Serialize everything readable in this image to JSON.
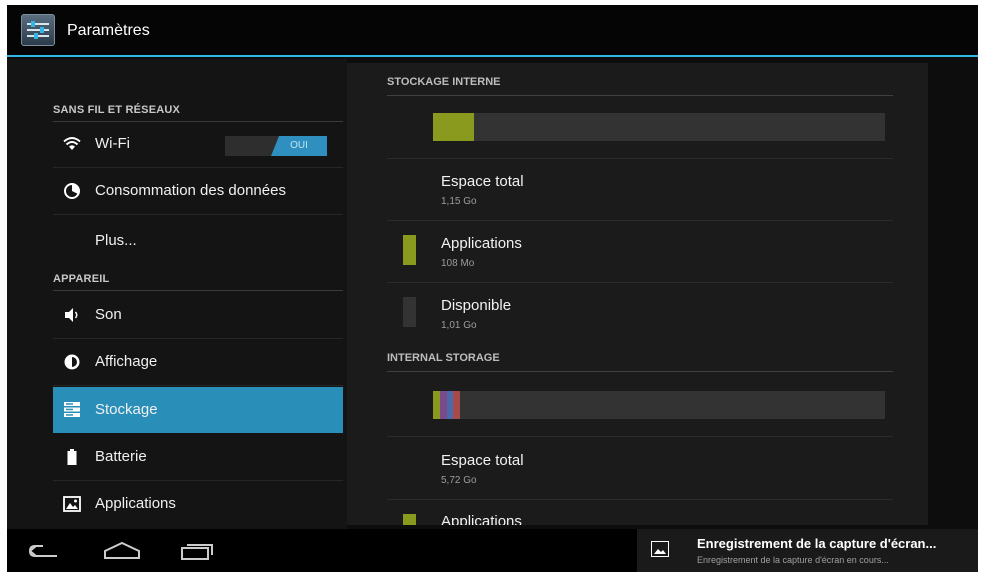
{
  "actionbar": {
    "title": "Paramètres",
    "icon": "settings-sliders-icon"
  },
  "left": {
    "sections": [
      {
        "header": "SANS FIL ET RÉSEAUX"
      },
      {
        "header": "APPAREIL"
      }
    ],
    "items": [
      {
        "label": "Wi-Fi",
        "icon": "wifi-icon",
        "toggle": "OUI"
      },
      {
        "label": "Consommation des données",
        "icon": "data-usage-icon"
      },
      {
        "label": "Plus..."
      },
      {
        "label": "Son",
        "icon": "volume-icon"
      },
      {
        "label": "Affichage",
        "icon": "brightness-icon"
      },
      {
        "label": "Stockage",
        "icon": "storage-icon",
        "selected": true
      },
      {
        "label": "Batterie",
        "icon": "battery-icon"
      },
      {
        "label": "Applications",
        "icon": "apps-icon"
      }
    ]
  },
  "storage": {
    "internal_fr": {
      "header": "STOCKAGE INTERNE",
      "used_fraction": 0.09,
      "total_label": "Espace total",
      "total_value": "1,15 Go",
      "apps_label": "Applications",
      "apps_value": "108 Mo",
      "free_label": "Disponible",
      "free_value": "1,01 Go"
    },
    "internal_en": {
      "header": "INTERNAL STORAGE",
      "segment_fractions": [
        0.015,
        0.015,
        0.015,
        0.015
      ],
      "total_label": "Espace total",
      "total_value": "5,72 Go",
      "apps_label": "Applications"
    },
    "colors": {
      "apps": "#8a9a1e",
      "free": "#333333",
      "seg1": "#8a9a1e",
      "seg2": "#7a4a8a",
      "seg3": "#4a6aaa",
      "seg4": "#a84a4a"
    }
  },
  "navbar": {
    "icons": [
      "back-icon",
      "home-icon",
      "recent-apps-icon"
    ]
  },
  "notification": {
    "title": "Enregistrement de la capture d'écran...",
    "subtitle": "Enregistrement de la capture d'écran en cours..."
  }
}
